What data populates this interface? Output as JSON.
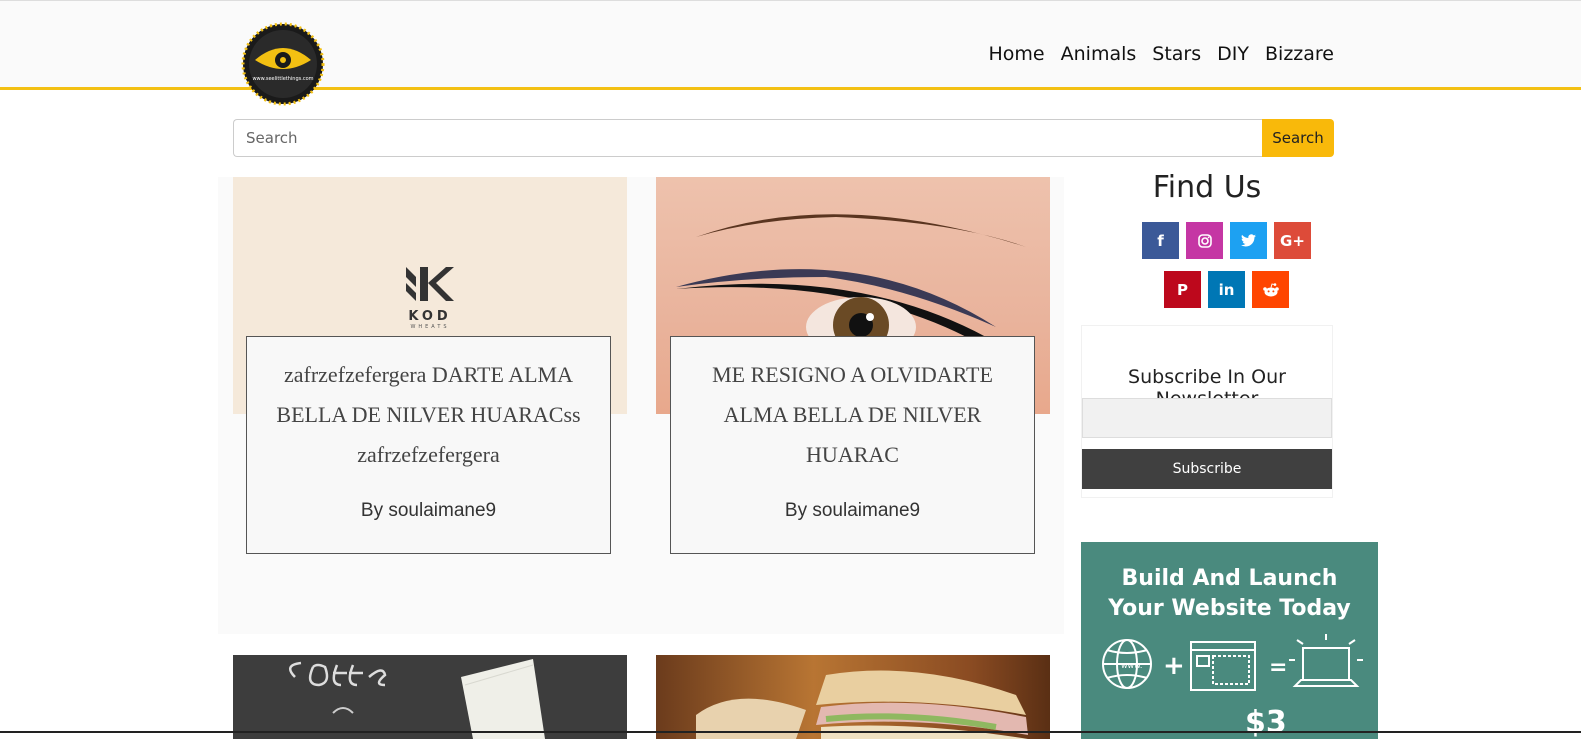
{
  "nav": {
    "items": [
      "Home",
      "Animals",
      "Stars",
      "DIY",
      "Bizzare"
    ]
  },
  "logo": {
    "text": "www.seelittlethings.com"
  },
  "search": {
    "placeholder": "Search",
    "button_label": "Search"
  },
  "posts": [
    {
      "title": "zafrzefzefergera DARTE ALMA BELLA DE NILVER HUARACss zafrzefzefergera",
      "author": "By soulaimane9",
      "image": {
        "brand": "KOD",
        "subtitle": "WHEATS"
      }
    },
    {
      "title": "ME RESIGNO A OLVIDARTE ALMA BELLA DE NILVER HUARAC",
      "author": "By soulaimane9"
    }
  ],
  "sidebar": {
    "find_us_title": "Find Us",
    "social": [
      {
        "name": "facebook",
        "glyph": "f",
        "color": "#3b5998"
      },
      {
        "name": "instagram",
        "glyph": "◎",
        "color": "#c536a4"
      },
      {
        "name": "twitter",
        "glyph": "🐦",
        "color": "#1da1f2"
      },
      {
        "name": "google-plus",
        "glyph": "G+",
        "color": "#dd4b39"
      },
      {
        "name": "pinterest",
        "glyph": "P",
        "color": "#bd081c"
      },
      {
        "name": "linkedin",
        "glyph": "in",
        "color": "#0077b5"
      },
      {
        "name": "reddit",
        "glyph": "👽",
        "color": "#ff4500"
      }
    ],
    "newsletter": {
      "title": "Subscribe In Our Newsletter",
      "button_label": "Subscribe"
    },
    "ad": {
      "title_line1": "Build And Launch",
      "title_line2": "Your Website Today",
      "price": "$3"
    }
  },
  "colors": {
    "accent": "#f3c012",
    "search_button": "#f9b90a",
    "subscribe_button": "#404040",
    "ad_background": "#4a8a7e"
  }
}
